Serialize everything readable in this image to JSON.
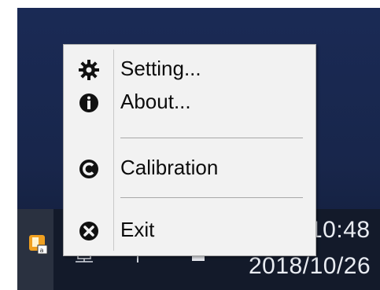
{
  "menu": {
    "items": [
      {
        "label": "Setting...",
        "icon": "gear-icon"
      },
      {
        "label": "About...",
        "icon": "info-icon"
      },
      {
        "label": "Calibration",
        "icon": "calibration-icon"
      },
      {
        "label": "Exit",
        "icon": "exit-icon"
      }
    ]
  },
  "taskbar": {
    "time": "10:48",
    "date": "2018/10/26"
  },
  "colors": {
    "menu_bg": "#f2f2f2",
    "taskbar_bg": "#131a2a",
    "desktop_bg": "#1a2a55",
    "tray_app_accent": "#f0a020"
  }
}
